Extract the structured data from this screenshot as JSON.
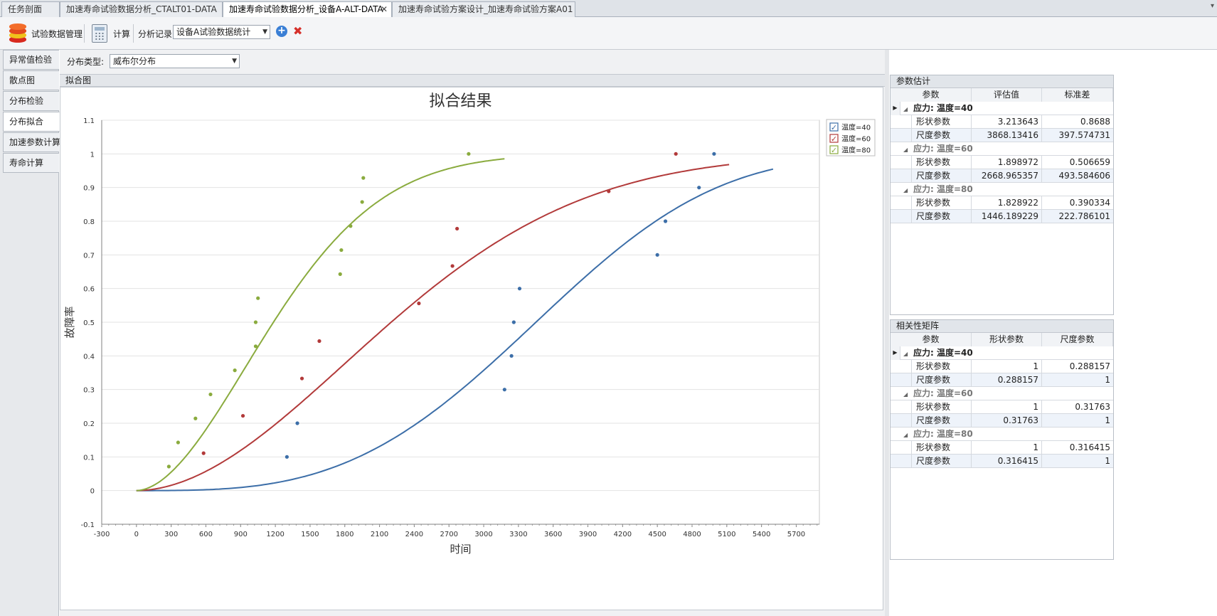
{
  "tabs": [
    {
      "label": "任务剖面"
    },
    {
      "label": "加速寿命试验数据分析_CTALT01-DATA"
    },
    {
      "label": "加速寿命试验数据分析_设备A-ALT-DATA",
      "active": true,
      "close": "✕"
    },
    {
      "label": "加速寿命试验方案设计_加速寿命试验方案A01"
    }
  ],
  "tabstrip_menu": "▾",
  "toolbar": {
    "data_mgmt_label": "试验数据管理",
    "calc_label": "计算",
    "history_label": "分析记录",
    "history_value": "设备A试验数据统计",
    "add_glyph": "+",
    "delete_glyph": "✖",
    "combo_arrow": "▼"
  },
  "nav": [
    {
      "label": "异常值检验"
    },
    {
      "label": "散点图"
    },
    {
      "label": "分布检验"
    },
    {
      "label": "分布拟合",
      "active": true
    },
    {
      "label": "加速参数计算"
    },
    {
      "label": "寿命计算"
    }
  ],
  "distribution": {
    "label": "分布类型:",
    "value": "威布尔分布"
  },
  "chart_panel_title": "拟合图",
  "colors": {
    "s40": "#3c6ea8",
    "s60": "#b23a3a",
    "s80": "#8aab3e",
    "grid": "#e3e3e3",
    "axis": "#808080"
  },
  "chart_data": {
    "type": "scatter",
    "title": "拟合结果",
    "xlabel": "时间",
    "ylabel": "故障率",
    "xlim": [
      -300,
      5900
    ],
    "ylim": [
      -0.1,
      1.1
    ],
    "xticks": [
      -300,
      0,
      300,
      600,
      900,
      1200,
      1500,
      1800,
      2100,
      2400,
      2700,
      3000,
      3300,
      3600,
      3900,
      4200,
      4500,
      4800,
      5100,
      5400,
      5700
    ],
    "yticks": [
      -0.1,
      0,
      0.1,
      0.2,
      0.3,
      0.4,
      0.5,
      0.6,
      0.7,
      0.8,
      0.9,
      1,
      1.1
    ],
    "legend_position": "top-right",
    "series": [
      {
        "name": "温度=40",
        "color_key": "s40",
        "weibull": {
          "shape": 3.213643,
          "scale": 3868.13416
        },
        "curve_range": [
          0,
          5500
        ],
        "points": [
          [
            1300,
            0.1
          ],
          [
            1390,
            0.2
          ],
          [
            3180,
            0.3
          ],
          [
            3240,
            0.4
          ],
          [
            3260,
            0.5
          ],
          [
            3310,
            0.6
          ],
          [
            4500,
            0.7
          ],
          [
            4570,
            0.8
          ],
          [
            4860,
            0.9
          ],
          [
            4990,
            1.0
          ]
        ]
      },
      {
        "name": "温度=60",
        "color_key": "s60",
        "weibull": {
          "shape": 1.898972,
          "scale": 2668.965357
        },
        "curve_range": [
          0,
          5120
        ],
        "points": [
          [
            580,
            0.111
          ],
          [
            920,
            0.222
          ],
          [
            1430,
            0.333
          ],
          [
            1580,
            0.444
          ],
          [
            2440,
            0.556
          ],
          [
            2730,
            0.667
          ],
          [
            2770,
            0.778
          ],
          [
            4080,
            0.889
          ],
          [
            4660,
            1.0
          ]
        ]
      },
      {
        "name": "温度=80",
        "color_key": "s80",
        "weibull": {
          "shape": 1.828922,
          "scale": 1446.189229
        },
        "curve_range": [
          0,
          3180
        ],
        "points": [
          [
            280,
            0.0714
          ],
          [
            360,
            0.1429
          ],
          [
            510,
            0.2143
          ],
          [
            640,
            0.2857
          ],
          [
            850,
            0.3571
          ],
          [
            1030,
            0.4286
          ],
          [
            1030,
            0.5
          ],
          [
            1050,
            0.5714
          ],
          [
            1760,
            0.6429
          ],
          [
            1770,
            0.7143
          ],
          [
            1850,
            0.7857
          ],
          [
            1950,
            0.8571
          ],
          [
            1960,
            0.9286
          ],
          [
            2870,
            1.0
          ]
        ]
      }
    ]
  },
  "param_panel": {
    "title": "参数估计",
    "headers": [
      "参数",
      "评估值",
      "标准差"
    ],
    "groups": [
      {
        "label": "应力: 温度=40",
        "rows": [
          {
            "name": "形状参数",
            "v1": "3.213643",
            "v2": "0.8688"
          },
          {
            "name": "尺度参数",
            "v1": "3868.13416",
            "v2": "397.574731"
          }
        ]
      },
      {
        "label": "应力: 温度=60",
        "rows": [
          {
            "name": "形状参数",
            "v1": "1.898972",
            "v2": "0.506659"
          },
          {
            "name": "尺度参数",
            "v1": "2668.965357",
            "v2": "493.584606"
          }
        ]
      },
      {
        "label": "应力: 温度=80",
        "rows": [
          {
            "name": "形状参数",
            "v1": "1.828922",
            "v2": "0.390334"
          },
          {
            "name": "尺度参数",
            "v1": "1446.189229",
            "v2": "222.786101"
          }
        ]
      }
    ]
  },
  "corr_panel": {
    "title": "相关性矩阵",
    "headers": [
      "参数",
      "形状参数",
      "尺度参数"
    ],
    "groups": [
      {
        "label": "应力: 温度=40",
        "rows": [
          {
            "name": "形状参数",
            "v1": "1",
            "v2": "0.288157"
          },
          {
            "name": "尺度参数",
            "v1": "0.288157",
            "v2": "1"
          }
        ]
      },
      {
        "label": "应力: 温度=60",
        "rows": [
          {
            "name": "形状参数",
            "v1": "1",
            "v2": "0.31763"
          },
          {
            "name": "尺度参数",
            "v1": "0.31763",
            "v2": "1"
          }
        ]
      },
      {
        "label": "应力: 温度=80",
        "rows": [
          {
            "name": "形状参数",
            "v1": "1",
            "v2": "0.316415"
          },
          {
            "name": "尺度参数",
            "v1": "0.316415",
            "v2": "1"
          }
        ]
      }
    ]
  },
  "glyphs": {
    "row_indicator": "▶",
    "expander": "◢",
    "check": "✓"
  }
}
